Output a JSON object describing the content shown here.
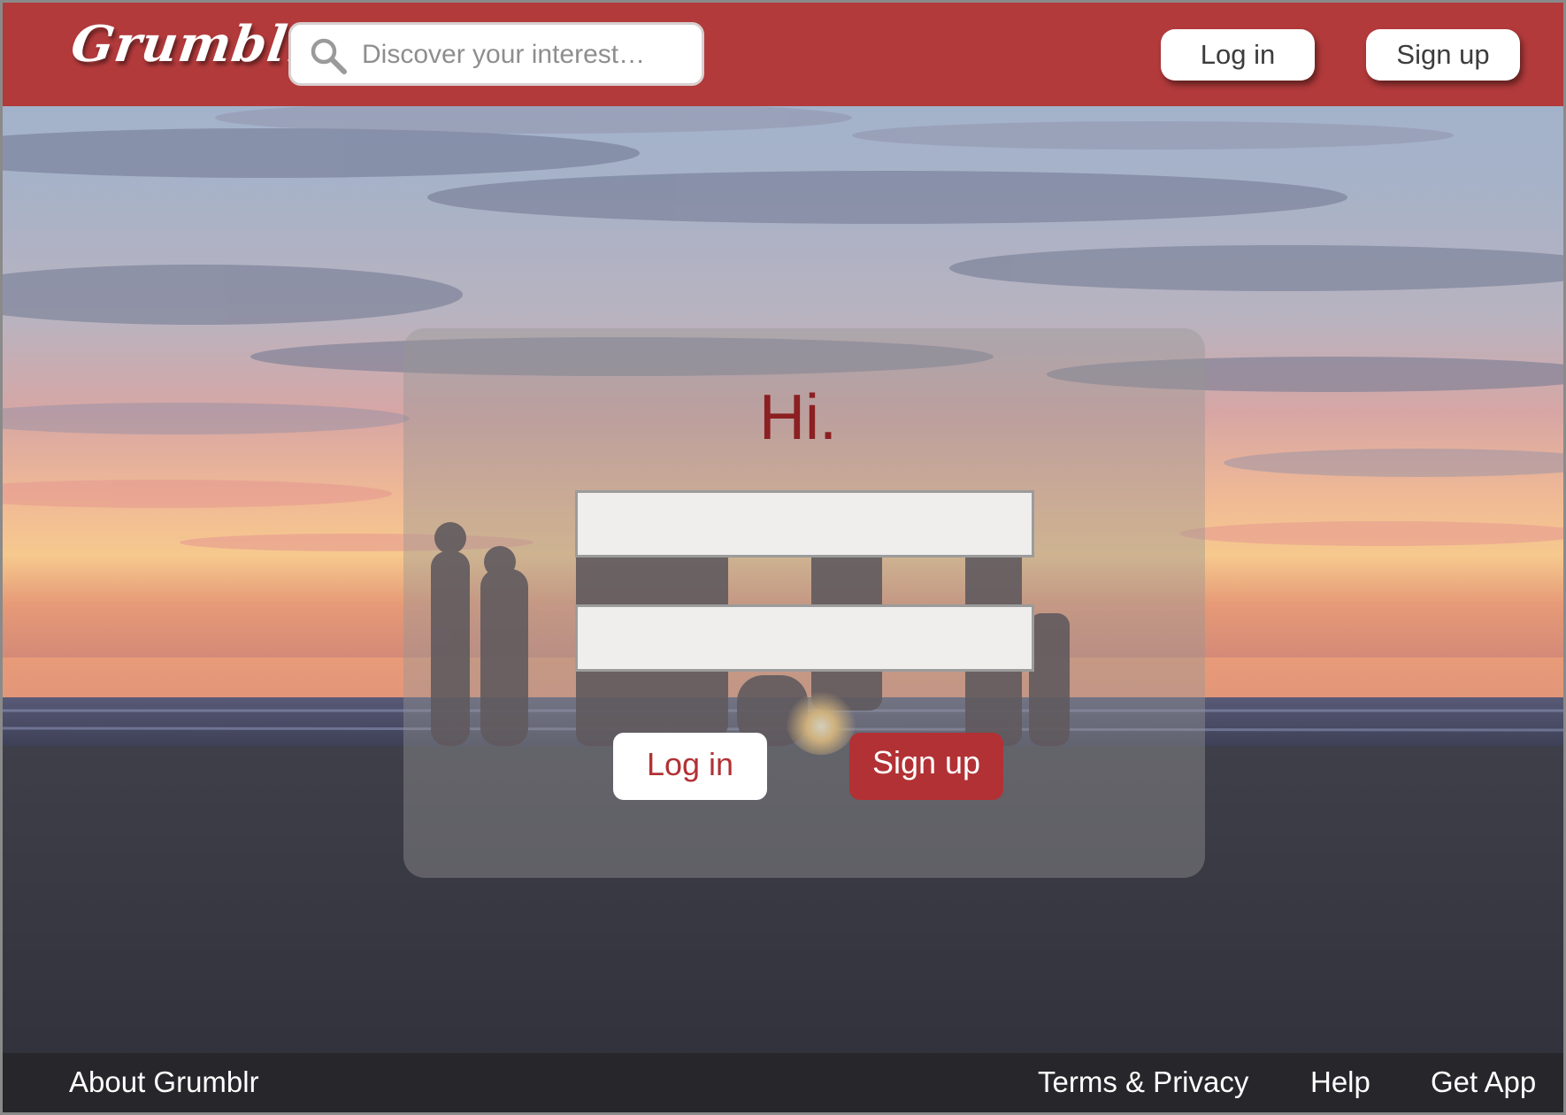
{
  "header": {
    "logo": "Grumblr",
    "search_placeholder": "Discover your interest…",
    "login_label": "Log in",
    "signup_label": "Sign up"
  },
  "card": {
    "greeting": "Hi.",
    "login_label": "Log in",
    "signup_label": "Sign up"
  },
  "footer": {
    "about": "About Grumblr",
    "terms": "Terms & Privacy",
    "help": "Help",
    "app": "Get App"
  },
  "colors": {
    "brand": "#b23a3b",
    "accent_text": "#8b1f21",
    "footer": "#26262b"
  },
  "icons": {
    "search": "search-icon"
  }
}
